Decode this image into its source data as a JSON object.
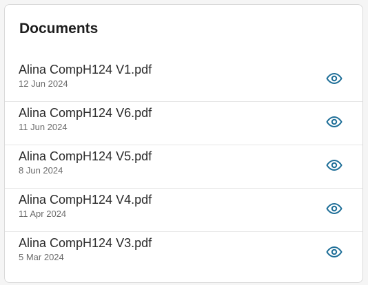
{
  "documents": {
    "title": "Documents",
    "accent_color": "#1f6f98",
    "items": [
      {
        "name": "Alina CompH124 V1.pdf",
        "date": "12 Jun 2024",
        "action_icon": "eye-icon"
      },
      {
        "name": "Alina CompH124 V6.pdf",
        "date": "11 Jun 2024",
        "action_icon": "eye-icon"
      },
      {
        "name": "Alina CompH124 V5.pdf",
        "date": "8 Jun 2024",
        "action_icon": "eye-icon"
      },
      {
        "name": "Alina CompH124 V4.pdf",
        "date": "11 Apr 2024",
        "action_icon": "eye-icon"
      },
      {
        "name": "Alina CompH124 V3.pdf",
        "date": "5 Mar 2024",
        "action_icon": "eye-icon"
      }
    ]
  }
}
